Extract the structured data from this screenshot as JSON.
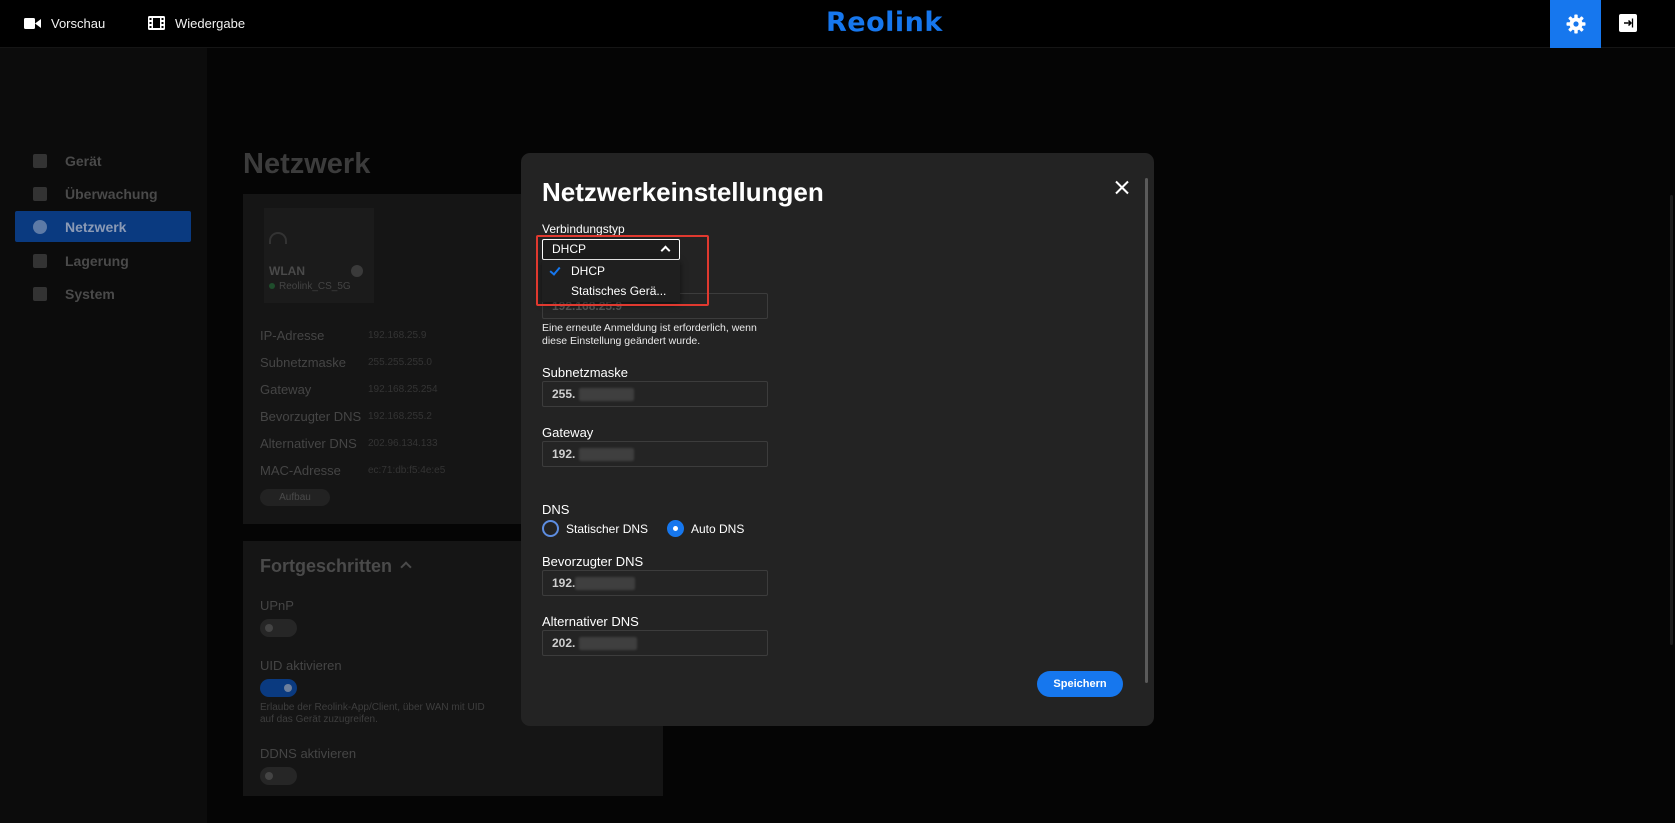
{
  "header": {
    "logo": "Reolink",
    "live_label": "Vorschau",
    "playback_label": "Wiedergabe"
  },
  "sidebar": {
    "items": [
      {
        "label": "Gerät"
      },
      {
        "label": "Überwachung"
      },
      {
        "label": "Netzwerk",
        "active": true
      },
      {
        "label": "Lagerung"
      },
      {
        "label": "System"
      }
    ]
  },
  "page": {
    "title": "Netzwerk",
    "wlan": {
      "title": "WLAN",
      "ssid": "Reolink_CS_5G"
    },
    "info_rows": [
      {
        "label": "IP-Adresse",
        "value": "192.168.25.9"
      },
      {
        "label": "Subnetzmaske",
        "value": "255.255.255.0"
      },
      {
        "label": "Gateway",
        "value": "192.168.25.254"
      },
      {
        "label": "Bevorzugter DNS",
        "value": "192.168.255.2"
      },
      {
        "label": "Alternativer DNS",
        "value": "202.96.134.133"
      },
      {
        "label": "MAC-Adresse",
        "value": "ec:71:db:f5:4e:e5"
      }
    ],
    "setup_button": "Aufbau",
    "advanced": {
      "title": "Fortgeschritten",
      "upnp_label": "UPnP",
      "upnp_enabled": false,
      "uid_label": "UID aktivieren",
      "uid_enabled": true,
      "uid_note": "Erlaube der Reolink-App/Client, über WAN mit UID auf das Gerät zuzugreifen.",
      "ddns_label": "DDNS aktivieren",
      "ddns_enabled": false
    }
  },
  "modal": {
    "title": "Netzwerkeinstellungen",
    "connection_type_label": "Verbindungstyp",
    "connection_type_value": "DHCP",
    "options": [
      {
        "label": "DHCP",
        "selected": true
      },
      {
        "label": "Statisches Gerä..."
      }
    ],
    "ip_value": "192.168.25.9",
    "relogin_note": "Eine erneute Anmeldung ist erforderlich, wenn diese Einstellung geändert wurde.",
    "subnet_label": "Subnetzmaske",
    "subnet_value": "255.",
    "gateway_label": "Gateway",
    "gateway_value": "192.",
    "dns_label": "DNS",
    "dns_static_label": "Statischer DNS",
    "dns_auto_label": "Auto DNS",
    "dns_mode": "auto",
    "preferred_dns_label": "Bevorzugter DNS",
    "preferred_dns_value": "192.",
    "alternative_dns_label": "Alternativer DNS",
    "alternative_dns_value": "202.",
    "save_label": "Speichern"
  },
  "colors": {
    "accent": "#1677ee",
    "highlight_box": "#e0392f",
    "modal_bg": "#232323"
  }
}
